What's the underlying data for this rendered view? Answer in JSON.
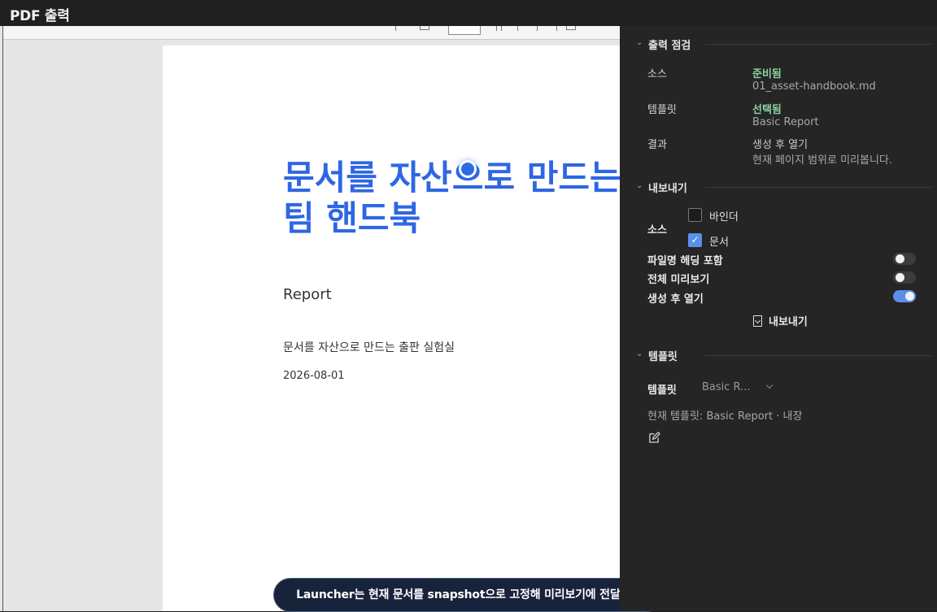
{
  "window": {
    "title": "PDF 출력"
  },
  "document": {
    "title_line1": "문서를 자산으로 만드는",
    "title_line2": "팀 핸드북",
    "subtitle": "Report",
    "meta": "문서를 자산으로 만드는 출판 실험실",
    "date": "2026-08-01"
  },
  "toast": {
    "text": "Launcher는 현재 문서를 snapshot으로 고정해 미리보기에 전달한다"
  },
  "panel": {
    "check": {
      "title": "출력 점검",
      "source_label": "소스",
      "source_status": "준비됨",
      "source_value": "01_asset-handbook.md",
      "template_label": "템플릿",
      "template_status": "선택됨",
      "template_value": "Basic Report",
      "result_label": "결과",
      "result_value1": "생성 후 열기",
      "result_value2": "현재 페이지 범위로 미리봅니다."
    },
    "export": {
      "title": "내보내기",
      "source_label": "소스",
      "option_binder": "바인더",
      "option_document": "문서",
      "toggle_filename_heading": "파일명 헤딩 포함",
      "toggle_full_preview": "전체 미리보기",
      "toggle_open_after": "생성 후 열기",
      "toggles": {
        "filename_heading": false,
        "full_preview": false,
        "open_after": true
      },
      "checkboxes": {
        "binder": false,
        "document": true
      },
      "export_button": "내보내기"
    },
    "template": {
      "title": "템플릿",
      "select_label": "템플릿",
      "select_value": "Basic R...",
      "current_info": "현재 템플릿: Basic Report · 내장"
    }
  },
  "colors": {
    "accent": "#2e67e3",
    "ok": "#8fd19e",
    "toggle_on": "#5b8fe8",
    "panel_bg": "#252525"
  }
}
